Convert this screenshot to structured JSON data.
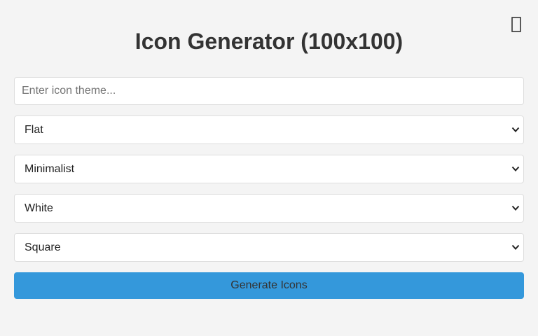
{
  "page": {
    "title": "Icon Generator (100x100)",
    "theme_toggle_icon": "moon-icon"
  },
  "form": {
    "theme_input": {
      "value": "",
      "placeholder": "Enter icon theme..."
    },
    "style_select": {
      "selected": "Flat"
    },
    "type_select": {
      "selected": "Minimalist"
    },
    "color_select": {
      "selected": "White"
    },
    "shape_select": {
      "selected": "Square"
    },
    "generate_label": "Generate Icons"
  },
  "colors": {
    "background": "#f4f4f4",
    "accent": "#3498db",
    "text": "#333333",
    "border": "#dddddd"
  }
}
